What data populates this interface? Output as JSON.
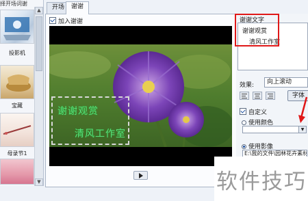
{
  "left_panel": {
    "title": "择开场词谢",
    "items": [
      {
        "label": "投影机"
      },
      {
        "label": "宝藏"
      },
      {
        "label": ""
      },
      {
        "label": "母录节1"
      }
    ]
  },
  "tabs": [
    {
      "label": "开场"
    },
    {
      "label": "谢谢"
    }
  ],
  "preview": {
    "add_credits_label": "加入谢谢",
    "caption_line1": "谢谢观赏",
    "caption_line2": "清风工作室"
  },
  "right_panel": {
    "title_text_label": "谢谢文字",
    "title_lines": [
      "谢谢观赏",
      "清风工作室"
    ],
    "effect_label": "效果:",
    "effect_value": "向上滚动",
    "font_button": "字体",
    "custom_label": "自定义",
    "use_color_label": "使用颜色",
    "use_image_label": "使用影像",
    "image_path": "E:\\我的文件\\园林花卉素材"
  },
  "watermark": "软件技巧",
  "colors": {
    "highlight_red": "#e01818",
    "caption_green": "#5fd67a",
    "preview_bg": "#000000"
  },
  "icons": {
    "play": "play-icon",
    "align_left": "align-left-icon",
    "align_center": "align-center-icon",
    "align_right": "align-right-icon",
    "arrow": "red-arrow-icon"
  }
}
